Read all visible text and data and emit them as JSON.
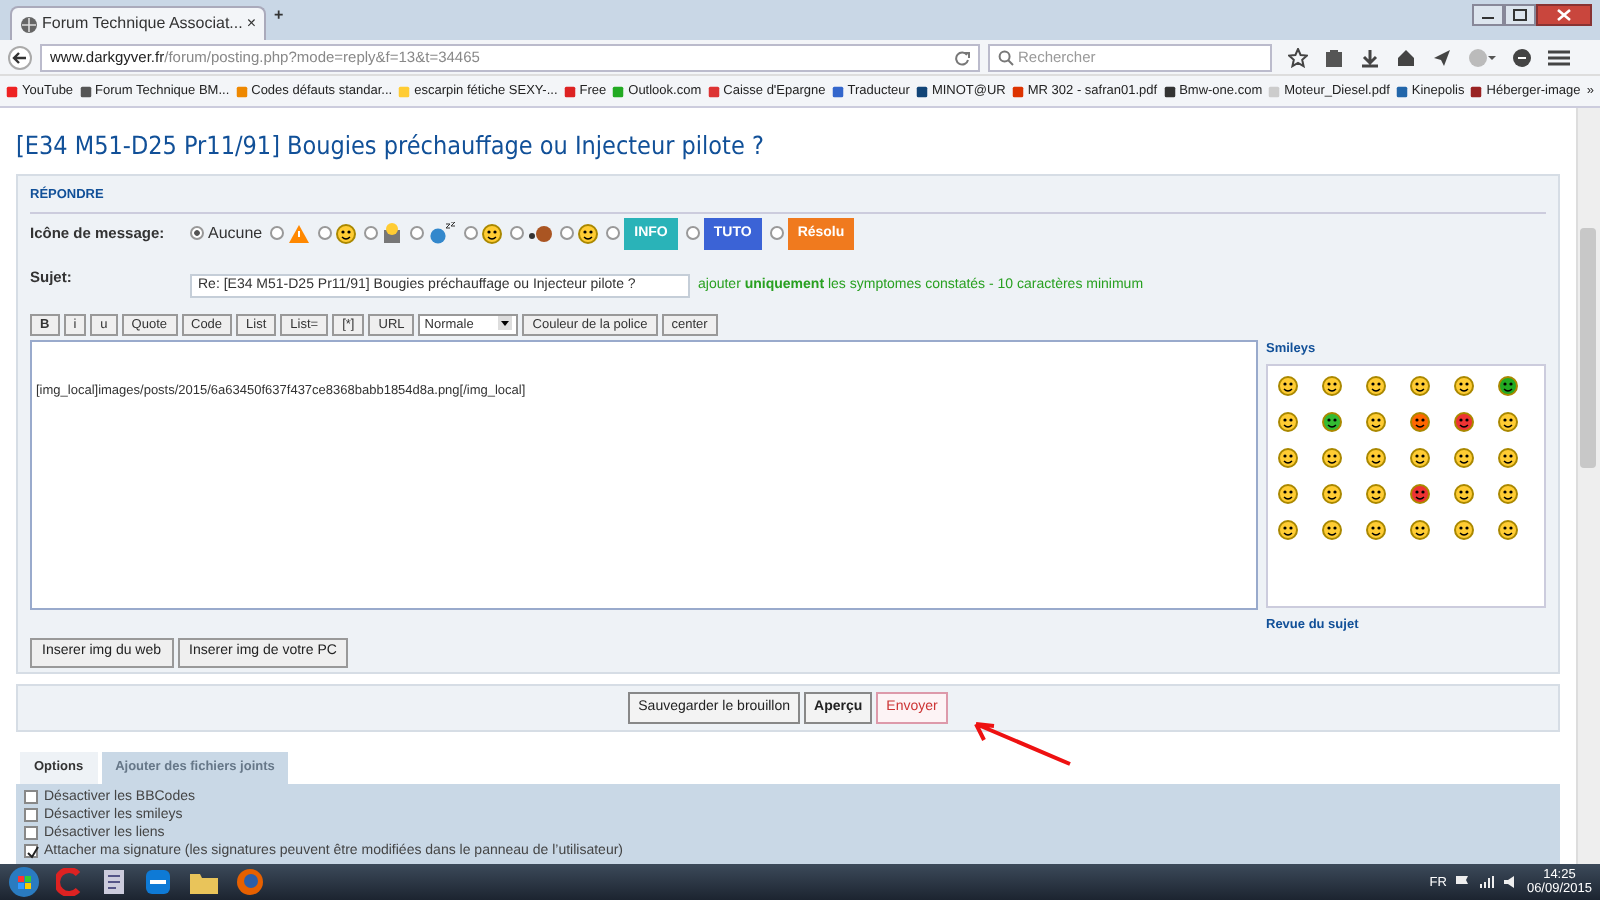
{
  "browser": {
    "tab": {
      "title": "Forum Technique Associat...",
      "close": "×"
    },
    "new_tab": "+",
    "url": {
      "host": "www.darkgyver.fr",
      "path": "/forum/posting.php?mode=reply&f=13&t=34465"
    },
    "search": {
      "placeholder": "Rechercher"
    },
    "bookmarks": [
      "YouTube",
      "Forum Technique BM...",
      "Codes défauts standar...",
      "escarpin fétiche SEXY-...",
      "Free",
      "Outlook.com",
      "Caisse d'Epargne",
      "Traducteur",
      "MINOT@UR",
      "MR 302 - safran01.pdf",
      "Bmw-one.com",
      "Moteur_Diesel.pdf",
      "Kinepolis",
      "Héberger-image"
    ],
    "bookmarks_more": "»"
  },
  "page": {
    "title": "[E34 M51-D25 Pr11/91] Bougies préchauffage ou Injecteur pilote ?",
    "section": "RÉPONDRE",
    "icon_label": "Icône de message:",
    "message_icons": [
      {
        "kind": "none",
        "label": "Aucune",
        "selected": true
      },
      {
        "kind": "warning",
        "selected": false
      },
      {
        "kind": "smiley",
        "selected": false
      },
      {
        "kind": "box",
        "selected": false
      },
      {
        "kind": "sleep",
        "selected": false
      },
      {
        "kind": "smiley",
        "selected": false
      },
      {
        "kind": "ball",
        "selected": false
      },
      {
        "kind": "smiley",
        "selected": false
      },
      {
        "kind": "badge",
        "label": "INFO",
        "color": "#2ab3b8",
        "selected": false
      },
      {
        "kind": "badge",
        "label": "TUTO",
        "color": "#3b63d6",
        "selected": false
      },
      {
        "kind": "badge",
        "label": "Résolu",
        "color": "#f07a1e",
        "selected": false
      }
    ],
    "subject_label": "Sujet:",
    "subject_value": "Re: [E34 M51-D25 Pr11/91] Bougies préchauffage ou Injecteur pilote ?",
    "subject_hint": "ajouter **uniquement** les symptomes constatés - 10 caractères minimum",
    "format_buttons": [
      {
        "kind": "button",
        "label": "B"
      },
      {
        "kind": "button",
        "label": "i"
      },
      {
        "kind": "button",
        "label": "u"
      },
      {
        "kind": "button",
        "label": "Quote"
      },
      {
        "kind": "button",
        "label": "Code"
      },
      {
        "kind": "button",
        "label": "List"
      },
      {
        "kind": "button",
        "label": "List="
      },
      {
        "kind": "button",
        "label": "[*]"
      },
      {
        "kind": "button",
        "label": "URL"
      },
      {
        "kind": "select",
        "label": "Normale"
      },
      {
        "kind": "button",
        "label": "Couleur de la police"
      },
      {
        "kind": "button",
        "label": "center"
      }
    ],
    "message": "[img_local]images/posts/2015/6a63450f637f437ce8368babb1854d8a.png[/img_local]",
    "smileys_title": "Smileys",
    "review_link": "Revue du sujet",
    "insert_buttons": [
      "Inserer img du web",
      "Inserer img de votre PC"
    ],
    "actions": [
      {
        "label": "Sauvegarder le brouillon",
        "kind": "normal"
      },
      {
        "label": "Aperçu",
        "kind": "bold"
      },
      {
        "label": "Envoyer",
        "kind": "primary"
      }
    ],
    "option_tabs": [
      {
        "label": "Options",
        "selected": true
      },
      {
        "label": "Ajouter des fichiers joints",
        "selected": false
      }
    ],
    "options": [
      {
        "label": "Désactiver les BBCodes",
        "checked": false
      },
      {
        "label": "Désactiver les smileys",
        "checked": false
      },
      {
        "label": "Désactiver les liens",
        "checked": false
      },
      {
        "label": "Attacher ma signature (les signatures peuvent être modifiées dans le panneau de l’utilisateur)",
        "checked": true
      }
    ]
  },
  "taskbar": {
    "language": "FR",
    "time": "14:25",
    "date": "06/09/2015"
  }
}
